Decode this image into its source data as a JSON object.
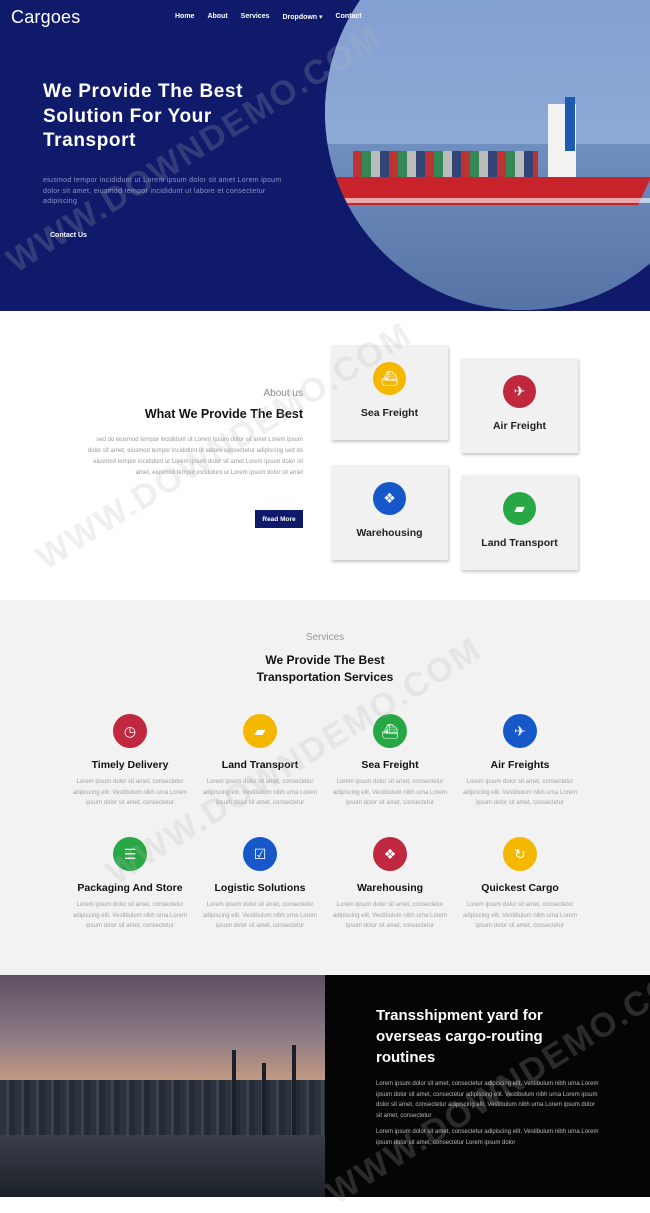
{
  "brand": "Cargoes",
  "nav": [
    "Home",
    "About",
    "Services",
    "Dropdown ▾",
    "Contact"
  ],
  "hero": {
    "title": "We Provide The Best Solution For Your Transport",
    "text": "eiusmod tempor incididunt ut Lorem ipsum dolor sit amet Lorem ipsum dolor sit amet, eiusmod tempor incididunt ut labore et consectetur adipiscing",
    "button": "Contact Us"
  },
  "about": {
    "kicker": "About us",
    "title": "What We Provide The Best",
    "text": "sed do eiusmod tempor incididunt ut Lorem ipsum dolor sit amet Lorem ipsum dolor sit amet, eiusmod tempor incididunt ut labore consectetur adipiscing sed do eiusmod tempor incididunt ut Lorem ipsum dolor sit amet Lorem ipsum dolor sit amet, eiusmod tempor incididunt ut Lorem ipsum dolor sit amet",
    "button": "Read More",
    "cards": [
      {
        "label": "Sea Freight",
        "icon": "ship-icon",
        "color": "#f5b800"
      },
      {
        "label": "Air Freight",
        "icon": "plane-icon",
        "color": "#c0283f"
      },
      {
        "label": "Warehousing",
        "icon": "boxes-icon",
        "color": "#1657c9"
      },
      {
        "label": "Land Transport",
        "icon": "truck-icon",
        "color": "#28a745"
      }
    ]
  },
  "services": {
    "kicker": "Services",
    "title": "We Provide The Best Transportation Services",
    "items": [
      {
        "name": "Timely Delivery",
        "icon": "clock-icon",
        "color": "#c0283f",
        "desc": "Lorem ipsum dolor sit amet, consectetur adipiscing elit. Vestibulum nibh urna Lorem ipsum dolor sit amet, consectetur"
      },
      {
        "name": "Land Transport",
        "icon": "truck-icon",
        "color": "#f5b800",
        "desc": "Lorem ipsum dolor sit amet, consectetur adipiscing elit. Vestibulum nibh urna Lorem ipsum dolor sit amet, consectetur"
      },
      {
        "name": "Sea Freight",
        "icon": "ship-icon",
        "color": "#28a745",
        "desc": "Lorem ipsum dolor sit amet, consectetur adipiscing elit. Vestibulum nibh urna Lorem ipsum dolor sit amet, consectetur"
      },
      {
        "name": "Air Freights",
        "icon": "plane-icon",
        "color": "#1657c9",
        "desc": "Lorem ipsum dolor sit amet, consectetur adipiscing elit. Vestibulum nibh urna Lorem ipsum dolor sit amet, consectetur"
      },
      {
        "name": "Packaging And Store",
        "icon": "database-icon",
        "color": "#28a745",
        "desc": "Lorem ipsum dolor sit amet, consectetur adipiscing elit. Vestibulum nibh urna Lorem ipsum dolor sit amet, consectetur"
      },
      {
        "name": "Logistic Solutions",
        "icon": "check-square-icon",
        "color": "#1657c9",
        "desc": "Lorem ipsum dolor sit amet, consectetur adipiscing elit. Vestibulum nibh urna Lorem ipsum dolor sit amet, consectetur"
      },
      {
        "name": "Warehousing",
        "icon": "boxes-icon",
        "color": "#c0283f",
        "desc": "Lorem ipsum dolor sit amet, consectetur adipiscing elit. Vestibulum nibh urna Lorem ipsum dolor sit amet, consectetur"
      },
      {
        "name": "Quickest Cargo",
        "icon": "circle-arrow-icon",
        "color": "#f5b800",
        "desc": "Lorem ipsum dolor sit amet, consectetur adipiscing elit. Vestibulum nibh urna Lorem ipsum dolor sit amet, consectetur"
      }
    ]
  },
  "bottom": {
    "title": "Transshipment yard for overseas cargo-routing routines",
    "text1": "Lorem ipsum dolor sit amet, consectetur adipiscing elit. Vestibulum nibh urna Lorem ipsum dolor sit amet, consectetur adipiscing elit. Vestibulum nibh urna Lorem ipsum dolor sit amet, consectetur adipiscing elit. Vestibulum nibh urna Lorem ipsum dolor sit amet, consectetur",
    "text2": "Lorem ipsum dolor sit amet, consectetur adipiscing elit. Vestibulum nibh urna Lorem ipsum dolor sit amet, consectetur Lorem ipsum dolor"
  },
  "watermark": "WWW.DOWNDEMO.COM"
}
